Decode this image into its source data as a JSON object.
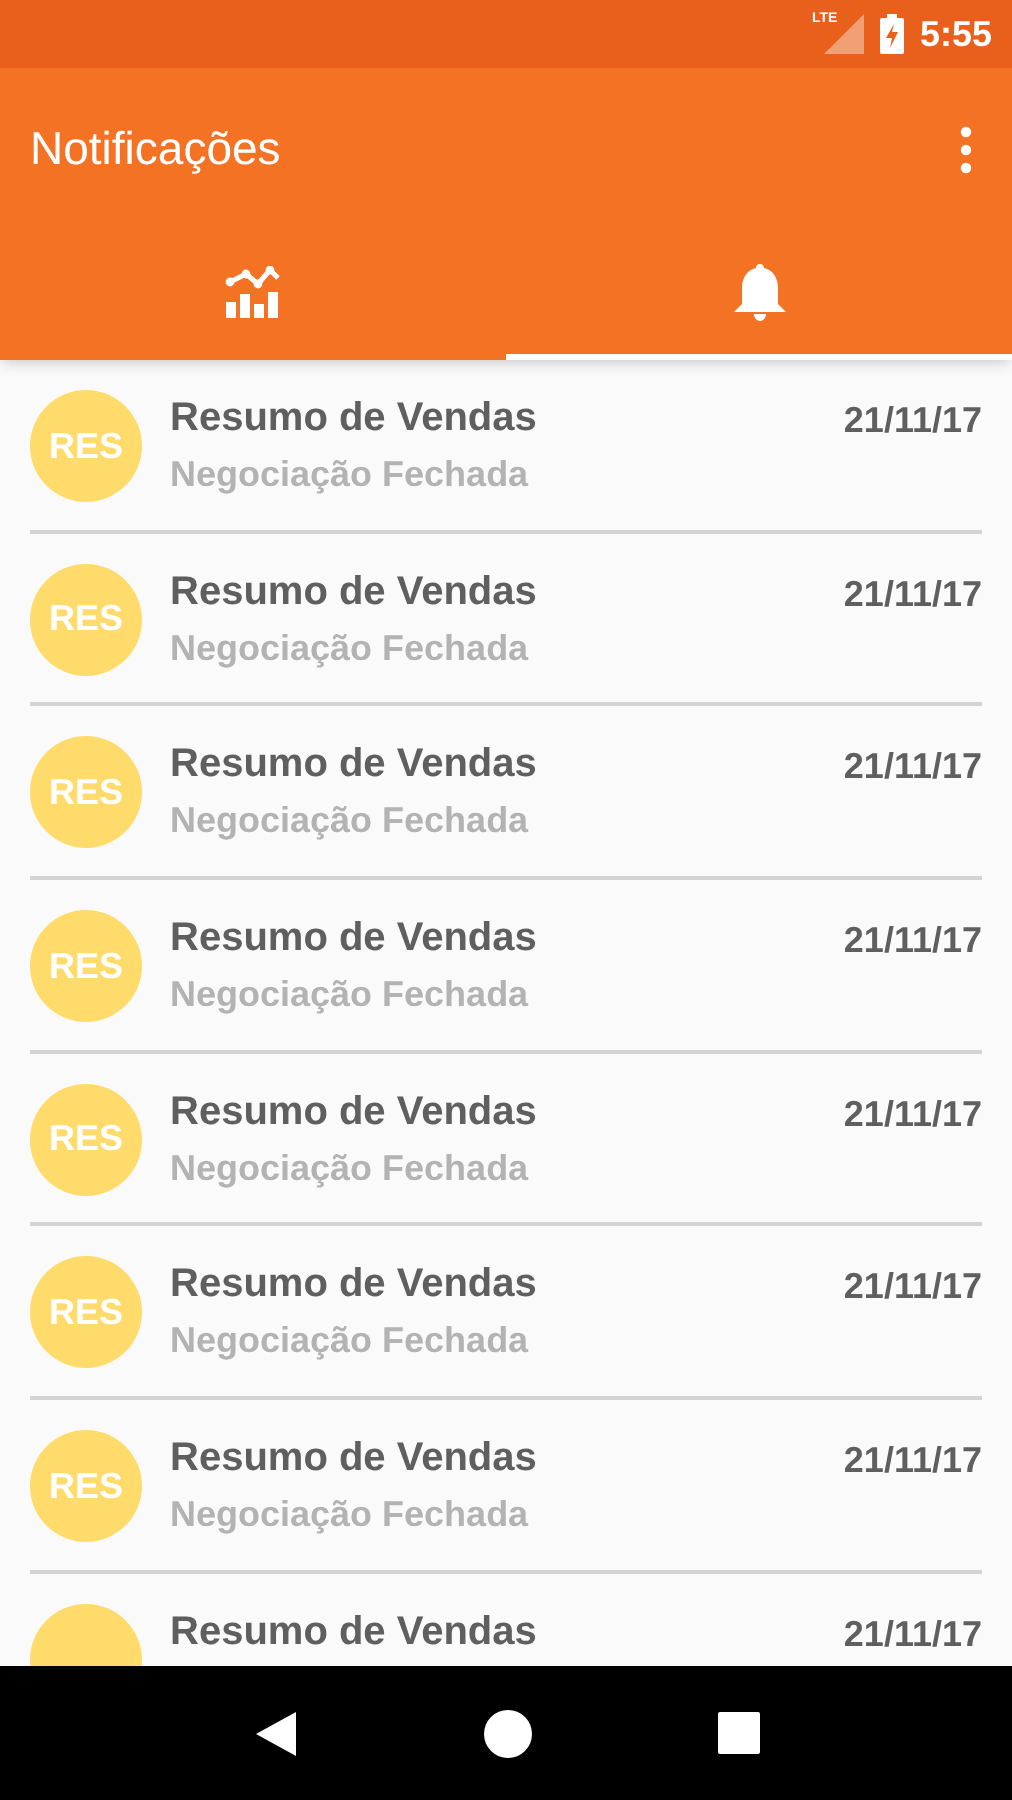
{
  "status_bar": {
    "network": "LTE",
    "time": "5:55"
  },
  "app_bar": {
    "title": "Notificações"
  },
  "tabs": [
    {
      "selected": false
    },
    {
      "selected": true
    }
  ],
  "notifications": [
    {
      "avatar": "RES",
      "title": "Resumo de Vendas",
      "subtitle": "Negociação Fechada",
      "date": "21/11/17"
    },
    {
      "avatar": "RES",
      "title": "Resumo de Vendas",
      "subtitle": "Negociação Fechada",
      "date": "21/11/17"
    },
    {
      "avatar": "RES",
      "title": "Resumo de Vendas",
      "subtitle": "Negociação Fechada",
      "date": "21/11/17"
    },
    {
      "avatar": "RES",
      "title": "Resumo de Vendas",
      "subtitle": "Negociação Fechada",
      "date": "21/11/17"
    },
    {
      "avatar": "RES",
      "title": "Resumo de Vendas",
      "subtitle": "Negociação Fechada",
      "date": "21/11/17"
    },
    {
      "avatar": "RES",
      "title": "Resumo de Vendas",
      "subtitle": "Negociação Fechada",
      "date": "21/11/17"
    },
    {
      "avatar": "RES",
      "title": "Resumo de Vendas",
      "subtitle": "Negociação Fechada",
      "date": "21/11/17"
    },
    {
      "title": "Resumo de Vendas",
      "date": "21/11/17"
    }
  ]
}
